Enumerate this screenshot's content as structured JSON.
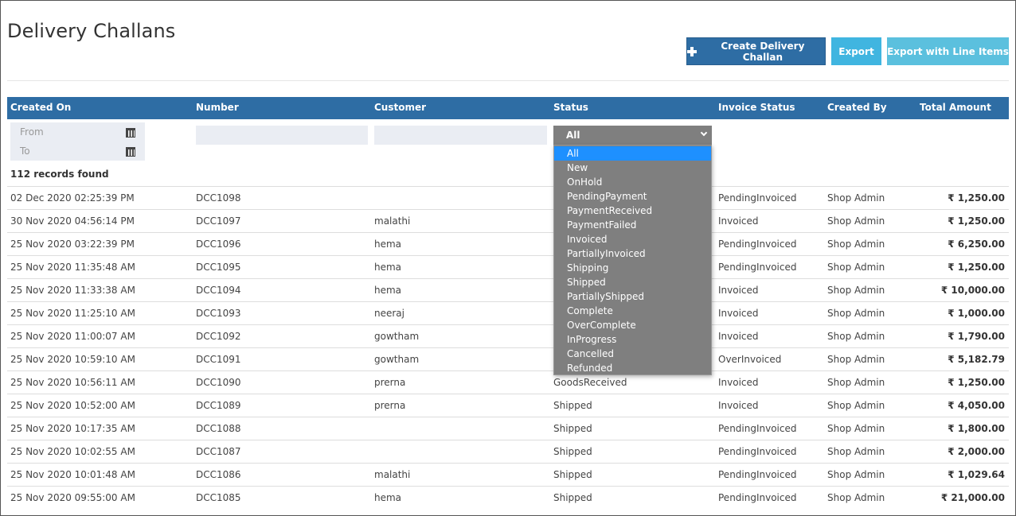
{
  "page": {
    "title": "Delivery Challans",
    "buttons": {
      "create": "Create Delivery Challan",
      "export": "Export",
      "export_line_items": "Export with Line Items"
    },
    "colors": {
      "header": "#2e6da4",
      "create_button": "#2e6da4",
      "export_button": "#40b5e0",
      "export_line_items_button": "#5bc0de",
      "dropdown": "#7f7f7f",
      "dropdown_selected": "#1e90ff"
    }
  },
  "grid": {
    "columns": [
      "Created On",
      "Number",
      "Customer",
      "Status",
      "Invoice Status",
      "Created By",
      "Total Amount"
    ],
    "filters": {
      "from_placeholder": "From",
      "to_placeholder": "To",
      "status_selected": "All"
    },
    "records_found": "112 records found",
    "rows": [
      {
        "created_on": "02 Dec 2020 02:25:39 PM",
        "number": "DCC1098",
        "customer": "",
        "status": "",
        "invoice_status": "PendingInvoiced",
        "created_by": "Shop Admin",
        "total": "₹ 1,250.00"
      },
      {
        "created_on": "30 Nov 2020 04:56:14 PM",
        "number": "DCC1097",
        "customer": "malathi",
        "status": "",
        "invoice_status": "Invoiced",
        "created_by": "Shop Admin",
        "total": "₹ 1,250.00"
      },
      {
        "created_on": "25 Nov 2020 03:22:39 PM",
        "number": "DCC1096",
        "customer": "hema",
        "status": "",
        "invoice_status": "PendingInvoiced",
        "created_by": "Shop Admin",
        "total": "₹ 6,250.00"
      },
      {
        "created_on": "25 Nov 2020 11:35:48 AM",
        "number": "DCC1095",
        "customer": "hema",
        "status": "",
        "invoice_status": "PendingInvoiced",
        "created_by": "Shop Admin",
        "total": "₹ 1,250.00"
      },
      {
        "created_on": "25 Nov 2020 11:33:38 AM",
        "number": "DCC1094",
        "customer": "hema",
        "status": "",
        "invoice_status": "Invoiced",
        "created_by": "Shop Admin",
        "total": "₹ 10,000.00"
      },
      {
        "created_on": "25 Nov 2020 11:25:10 AM",
        "number": "DCC1093",
        "customer": "neeraj",
        "status": "",
        "invoice_status": "Invoiced",
        "created_by": "Shop Admin",
        "total": "₹ 1,000.00"
      },
      {
        "created_on": "25 Nov 2020 11:00:07 AM",
        "number": "DCC1092",
        "customer": "gowtham",
        "status": "",
        "invoice_status": "Invoiced",
        "created_by": "Shop Admin",
        "total": "₹ 1,790.00"
      },
      {
        "created_on": "25 Nov 2020 10:59:10 AM",
        "number": "DCC1091",
        "customer": "gowtham",
        "status": "",
        "invoice_status": "OverInvoiced",
        "created_by": "Shop Admin",
        "total": "₹ 5,182.79"
      },
      {
        "created_on": "25 Nov 2020 10:56:11 AM",
        "number": "DCC1090",
        "customer": "prerna",
        "status": "GoodsReceived",
        "invoice_status": "Invoiced",
        "created_by": "Shop Admin",
        "total": "₹ 1,250.00"
      },
      {
        "created_on": "25 Nov 2020 10:52:00 AM",
        "number": "DCC1089",
        "customer": "prerna",
        "status": "Shipped",
        "invoice_status": "Invoiced",
        "created_by": "Shop Admin",
        "total": "₹ 4,050.00"
      },
      {
        "created_on": "25 Nov 2020 10:17:35 AM",
        "number": "DCC1088",
        "customer": "",
        "status": "Shipped",
        "invoice_status": "PendingInvoiced",
        "created_by": "Shop Admin",
        "total": "₹ 1,800.00"
      },
      {
        "created_on": "25 Nov 2020 10:02:55 AM",
        "number": "DCC1087",
        "customer": "",
        "status": "Shipped",
        "invoice_status": "PendingInvoiced",
        "created_by": "Shop Admin",
        "total": "₹ 2,000.00"
      },
      {
        "created_on": "25 Nov 2020 10:01:48 AM",
        "number": "DCC1086",
        "customer": "malathi",
        "status": "Shipped",
        "invoice_status": "PendingInvoiced",
        "created_by": "Shop Admin",
        "total": "₹ 1,029.64"
      },
      {
        "created_on": "25 Nov 2020 09:55:00 AM",
        "number": "DCC1085",
        "customer": "hema",
        "status": "Shipped",
        "invoice_status": "PendingInvoiced",
        "created_by": "Shop Admin",
        "total": "₹ 21,000.00"
      }
    ]
  },
  "status_dropdown": {
    "options": [
      "All",
      "New",
      "OnHold",
      "PendingPayment",
      "PaymentReceived",
      "PaymentFailed",
      "Invoiced",
      "PartiallyInvoiced",
      "Shipping",
      "Shipped",
      "PartiallyShipped",
      "Complete",
      "OverComplete",
      "InProgress",
      "Cancelled",
      "Refunded"
    ],
    "highlighted": "All"
  }
}
